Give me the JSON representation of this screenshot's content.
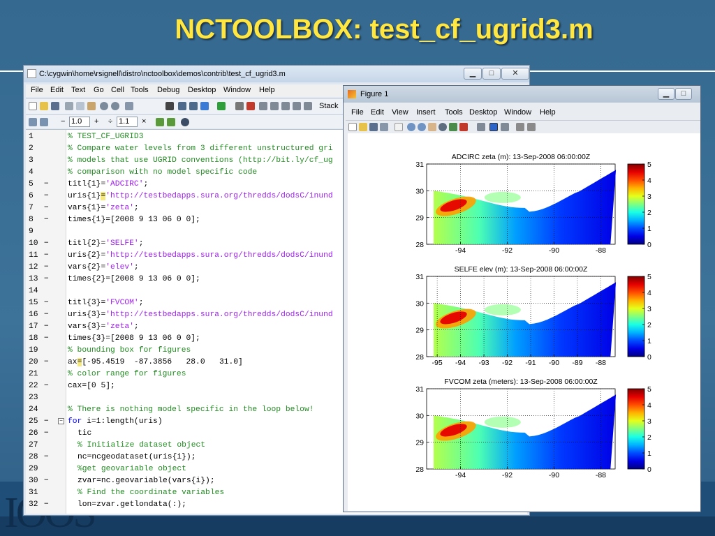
{
  "slide": {
    "title": "NCTOOLBOX: test_cf_ugrid3.m",
    "logo_text": "IOOS"
  },
  "editor": {
    "title": "C:\\cygwin\\home\\rsignell\\distro\\nctoolbox\\demos\\contrib\\test_cf_ugrid3.m",
    "menu": [
      "File",
      "Edit",
      "Text",
      "Go",
      "Cell",
      "Tools",
      "Debug",
      "Desktop",
      "Window",
      "Help"
    ],
    "toolbar": {
      "stack_label": "Stack"
    },
    "cell_toolbar": {
      "minus": "−",
      "value1": "1.0",
      "plus": "+",
      "divide": "÷",
      "value2": "1.1",
      "times": "×"
    },
    "lines": [
      {
        "n": "1",
        "bp": "",
        "fold": "",
        "indent": 0,
        "parts": [
          [
            "c",
            "% TEST_CF_UGRID3"
          ]
        ]
      },
      {
        "n": "2",
        "bp": "",
        "fold": "",
        "indent": 0,
        "parts": [
          [
            "c",
            "% Compare water levels from 3 different unstructured gri"
          ]
        ]
      },
      {
        "n": "3",
        "bp": "",
        "fold": "",
        "indent": 0,
        "parts": [
          [
            "c",
            "% models that use UGRID conventions (http://bit.ly/cf_ug"
          ]
        ]
      },
      {
        "n": "4",
        "bp": "",
        "fold": "",
        "indent": 0,
        "parts": [
          [
            "c",
            "% comparison with no model specific code"
          ]
        ]
      },
      {
        "n": "5",
        "bp": "−",
        "fold": "",
        "indent": 0,
        "parts": [
          [
            "p",
            "titl{1}="
          ],
          [
            "s",
            "'ADCIRC'"
          ],
          [
            "p",
            ";"
          ]
        ]
      },
      {
        "n": "6",
        "bp": "−",
        "fold": "",
        "indent": 0,
        "parts": [
          [
            "p",
            "uris{1}"
          ],
          [
            "m",
            "="
          ],
          [
            "s",
            "'http://testbedapps.sura.org/thredds/dodsC/inund"
          ]
        ]
      },
      {
        "n": "7",
        "bp": "−",
        "fold": "",
        "indent": 0,
        "parts": [
          [
            "p",
            "vars{1}="
          ],
          [
            "s",
            "'zeta'"
          ],
          [
            "p",
            ";"
          ]
        ]
      },
      {
        "n": "8",
        "bp": "−",
        "fold": "",
        "indent": 0,
        "parts": [
          [
            "p",
            "times{1}=[2008 9 13 06 0 0];"
          ]
        ]
      },
      {
        "n": "9",
        "bp": "",
        "fold": "",
        "indent": 0,
        "parts": []
      },
      {
        "n": "10",
        "bp": "−",
        "fold": "",
        "indent": 0,
        "parts": [
          [
            "p",
            "titl{2}="
          ],
          [
            "s",
            "'SELFE'"
          ],
          [
            "p",
            ";"
          ]
        ]
      },
      {
        "n": "11",
        "bp": "−",
        "fold": "",
        "indent": 0,
        "parts": [
          [
            "p",
            "uris{2}="
          ],
          [
            "s",
            "'http://testbedapps.sura.org/thredds/dodsC/inund"
          ]
        ]
      },
      {
        "n": "12",
        "bp": "−",
        "fold": "",
        "indent": 0,
        "parts": [
          [
            "p",
            "vars{2}="
          ],
          [
            "s",
            "'elev'"
          ],
          [
            "p",
            ";"
          ]
        ]
      },
      {
        "n": "13",
        "bp": "−",
        "fold": "",
        "indent": 0,
        "parts": [
          [
            "p",
            "times{2}=[2008 9 13 06 0 0];"
          ]
        ]
      },
      {
        "n": "14",
        "bp": "",
        "fold": "",
        "indent": 0,
        "parts": []
      },
      {
        "n": "15",
        "bp": "−",
        "fold": "",
        "indent": 0,
        "parts": [
          [
            "p",
            "titl{3}="
          ],
          [
            "s",
            "'FVCOM'"
          ],
          [
            "p",
            ";"
          ]
        ]
      },
      {
        "n": "16",
        "bp": "−",
        "fold": "",
        "indent": 0,
        "parts": [
          [
            "p",
            "uris{3}="
          ],
          [
            "s",
            "'http://testbedapps.sura.org/thredds/dodsC/inund"
          ]
        ]
      },
      {
        "n": "17",
        "bp": "−",
        "fold": "",
        "indent": 0,
        "parts": [
          [
            "p",
            "vars{3}="
          ],
          [
            "s",
            "'zeta'"
          ],
          [
            "p",
            ";"
          ]
        ]
      },
      {
        "n": "18",
        "bp": "−",
        "fold": "",
        "indent": 0,
        "parts": [
          [
            "p",
            "times{3}=[2008 9 13 06 0 0];"
          ]
        ]
      },
      {
        "n": "19",
        "bp": "",
        "fold": "",
        "indent": 0,
        "parts": [
          [
            "c",
            "% bounding box for figures"
          ]
        ]
      },
      {
        "n": "20",
        "bp": "−",
        "fold": "",
        "indent": 0,
        "parts": [
          [
            "p",
            "ax"
          ],
          [
            "m",
            "="
          ],
          [
            "p",
            "[-95.4519  -87.3856   28.0   31.0]"
          ]
        ]
      },
      {
        "n": "21",
        "bp": "",
        "fold": "",
        "indent": 0,
        "parts": [
          [
            "c",
            "% color range for figures"
          ]
        ]
      },
      {
        "n": "22",
        "bp": "−",
        "fold": "",
        "indent": 0,
        "parts": [
          [
            "p",
            "cax=[0 5];"
          ]
        ]
      },
      {
        "n": "23",
        "bp": "",
        "fold": "",
        "indent": 0,
        "parts": []
      },
      {
        "n": "24",
        "bp": "",
        "fold": "",
        "indent": 0,
        "parts": [
          [
            "c",
            "% There is nothing model specific in the loop below!"
          ]
        ]
      },
      {
        "n": "25",
        "bp": "−",
        "fold": "−",
        "indent": 0,
        "parts": [
          [
            "k",
            "for "
          ],
          [
            "p",
            "i=1:length(uris)"
          ]
        ]
      },
      {
        "n": "26",
        "bp": "−",
        "fold": "",
        "indent": 1,
        "parts": [
          [
            "p",
            "tic"
          ]
        ]
      },
      {
        "n": "27",
        "bp": "",
        "fold": "",
        "indent": 1,
        "parts": [
          [
            "c",
            "% Initialize dataset object"
          ]
        ]
      },
      {
        "n": "28",
        "bp": "−",
        "fold": "",
        "indent": 1,
        "parts": [
          [
            "p",
            "nc=ncgeodataset(uris{i});"
          ]
        ]
      },
      {
        "n": "29",
        "bp": "",
        "fold": "",
        "indent": 1,
        "parts": [
          [
            "c",
            "%get geovariable object"
          ]
        ]
      },
      {
        "n": "30",
        "bp": "−",
        "fold": "",
        "indent": 1,
        "parts": [
          [
            "p",
            "zvar=nc.geovariable(vars{i});"
          ]
        ]
      },
      {
        "n": "31",
        "bp": "",
        "fold": "",
        "indent": 1,
        "parts": [
          [
            "c",
            "% Find the coordinate variables"
          ]
        ]
      },
      {
        "n": "32",
        "bp": "−",
        "fold": "",
        "indent": 1,
        "parts": [
          [
            "p",
            "lon=zvar.getlondata(:);"
          ]
        ]
      }
    ]
  },
  "figure": {
    "title": "Figure 1",
    "menu": [
      "File",
      "Edit",
      "View",
      "Insert",
      "Tools",
      "Desktop",
      "Window",
      "Help"
    ]
  },
  "chart_data": [
    {
      "type": "heatmap",
      "title": "ADCIRC zeta (m): 13-Sep-2008 06:00:00Z",
      "xticks": [
        "-94",
        "-92",
        "-90",
        "-88"
      ],
      "xtick_values": [
        -94,
        -92,
        -90,
        -88
      ],
      "yticks": [
        "31",
        "30",
        "29",
        "28"
      ],
      "ytick_values": [
        31,
        30,
        29,
        28
      ],
      "xlim": [
        -95.4519,
        -87.3856
      ],
      "ylim": [
        28.0,
        31.0
      ],
      "colorbar_ticks": [
        "5",
        "4",
        "3",
        "2",
        "1",
        "0"
      ],
      "colorbar_values": [
        5,
        4,
        3,
        2,
        1,
        0
      ],
      "clim": [
        0,
        5
      ],
      "grid": true
    },
    {
      "type": "heatmap",
      "title": "SELFE elev (m): 13-Sep-2008 06:00:00Z",
      "xticks": [
        "-95",
        "-94",
        "-93",
        "-92",
        "-91",
        "-90",
        "-89",
        "-88"
      ],
      "xtick_values": [
        -95,
        -94,
        -93,
        -92,
        -91,
        -90,
        -89,
        -88
      ],
      "yticks": [
        "31",
        "30",
        "29",
        "28"
      ],
      "ytick_values": [
        31,
        30,
        29,
        28
      ],
      "xlim": [
        -95.4519,
        -87.3856
      ],
      "ylim": [
        28.0,
        31.0
      ],
      "colorbar_ticks": [
        "5",
        "4",
        "3",
        "2",
        "1",
        "0"
      ],
      "colorbar_values": [
        5,
        4,
        3,
        2,
        1,
        0
      ],
      "clim": [
        0,
        5
      ],
      "grid": true
    },
    {
      "type": "heatmap",
      "title": "FVCOM zeta (meters): 13-Sep-2008 06:00:00Z",
      "xticks": [
        "-94",
        "-92",
        "-90",
        "-88"
      ],
      "xtick_values": [
        -94,
        -92,
        -90,
        -88
      ],
      "yticks": [
        "31",
        "30",
        "29",
        "28"
      ],
      "ytick_values": [
        31,
        30,
        29,
        28
      ],
      "xlim": [
        -95.4519,
        -87.3856
      ],
      "ylim": [
        28.0,
        31.0
      ],
      "colorbar_ticks": [
        "5",
        "4",
        "3",
        "2",
        "1",
        "0"
      ],
      "colorbar_values": [
        5,
        4,
        3,
        2,
        1,
        0
      ],
      "clim": [
        0,
        5
      ],
      "grid": true
    }
  ]
}
